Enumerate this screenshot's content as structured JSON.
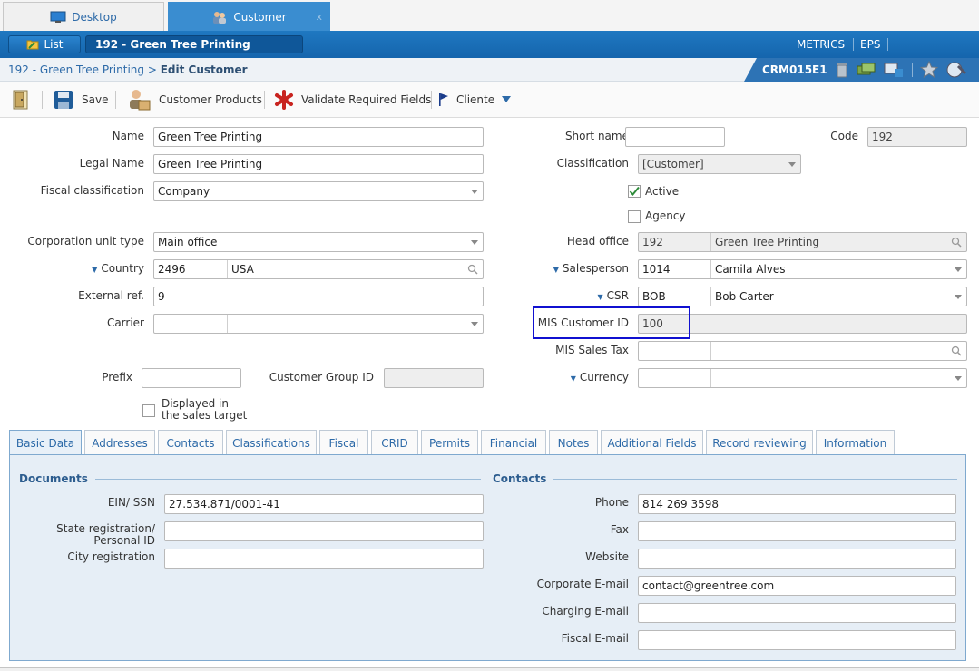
{
  "window_tabs": [
    {
      "label": "Desktop",
      "icon": "monitor-icon"
    },
    {
      "label": "Customer",
      "icon": "users-icon",
      "close": "x"
    }
  ],
  "topbar": {
    "list_label": "List",
    "record_label": "192 - Green Tree Printing",
    "metrics_label": "METRICS",
    "eps_label": "EPS"
  },
  "breadcrumb": {
    "parent": "192 - Green Tree Printing",
    "separator": ">",
    "current": "Edit Customer",
    "screen_code": "CRM015E1"
  },
  "toolbar": {
    "save_label": "Save",
    "customer_products_label": "Customer Products",
    "validate_label": "Validate Required Fields",
    "cliente_label": "Cliente"
  },
  "form": {
    "name_label": "Name",
    "name_value": "Green Tree Printing",
    "legal_name_label": "Legal Name",
    "legal_name_value": "Green Tree Printing",
    "fiscal_class_label": "Fiscal classification",
    "fiscal_class_value": "Company",
    "corp_unit_label": "Corporation unit type",
    "corp_unit_value": "Main office",
    "country_label": "Country",
    "country_code": "2496",
    "country_name": "USA",
    "external_ref_label": "External ref.",
    "external_ref_value": "9",
    "carrier_label": "Carrier",
    "prefix_label": "Prefix",
    "customer_group_label": "Customer Group ID",
    "displayed_label_1": "Displayed in",
    "displayed_label_2": "the sales target",
    "short_name_label": "Short name",
    "code_label": "Code",
    "code_value": "192",
    "classification_label": "Classification",
    "classification_value": "[Customer]",
    "active_label": "Active",
    "agency_label": "Agency",
    "head_office_label": "Head office",
    "head_office_code": "192",
    "head_office_name": "Green Tree Printing",
    "salesperson_label": "Salesperson",
    "salesperson_code": "1014",
    "salesperson_name": "Camila Alves",
    "csr_label": "CSR",
    "csr_code": "BOB",
    "csr_name": "Bob Carter",
    "mis_customer_label": "MIS Customer ID",
    "mis_customer_value": "100",
    "mis_sales_tax_label": "MIS Sales Tax",
    "currency_label": "Currency"
  },
  "tabs": [
    "Basic Data",
    "Addresses",
    "Contacts",
    "Classifications",
    "Fiscal",
    "CRID",
    "Permits",
    "Financial",
    "Notes",
    "Additional Fields",
    "Record reviewing",
    "Information"
  ],
  "basic_data": {
    "documents_title": "Documents",
    "ein_label": "EIN/ SSN",
    "ein_value": "27.534.871/0001-41",
    "state_reg_label_1": "State registration/",
    "state_reg_label_2": "Personal ID",
    "city_reg_label": "City registration",
    "contacts_title": "Contacts",
    "phone_label": "Phone",
    "phone_value": "814 269 3598",
    "fax_label": "Fax",
    "website_label": "Website",
    "corp_email_label": "Corporate E-mail",
    "corp_email_value": "contact@greentree.com",
    "charging_email_label": "Charging E-mail",
    "fiscal_email_label": "Fiscal E-mail"
  },
  "colors": {
    "accent": "#1f78c1",
    "highlight_box": "#1010d0"
  }
}
